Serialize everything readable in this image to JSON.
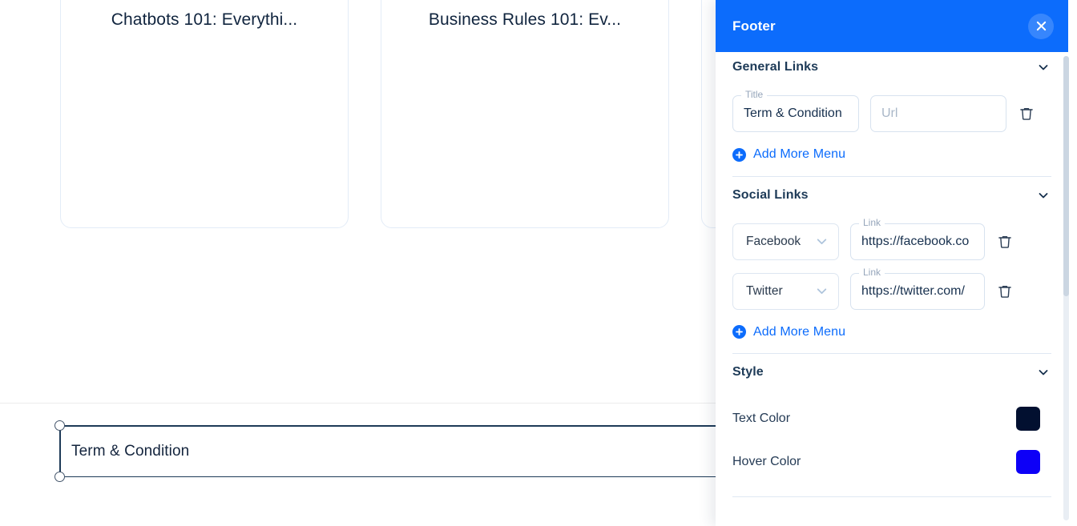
{
  "canvas": {
    "cards": [
      {
        "title": "Chatbots 101: Everythi..."
      },
      {
        "title": "Business Rules 101: Ev..."
      },
      {
        "title": ""
      }
    ],
    "selected_element": {
      "label": "Term & Condition"
    }
  },
  "panel": {
    "header": {
      "title": "Footer",
      "close_label": "×"
    },
    "sections": [
      {
        "id": "general-links",
        "title": "General Links",
        "rows": [
          {
            "title_legend": "Title",
            "title_value": "Term & Condition",
            "url_placeholder": "Url",
            "url_value": ""
          }
        ],
        "add_more_label": "Add More Menu"
      },
      {
        "id": "social-links",
        "title": "Social Links",
        "rows": [
          {
            "network": "Facebook",
            "link_legend": "Link",
            "link_value": "https://facebook.co"
          },
          {
            "network": "Twitter",
            "link_legend": "Link",
            "link_value": "https://twitter.com/"
          }
        ],
        "add_more_label": "Add More Menu"
      },
      {
        "id": "style",
        "title": "Style",
        "rows": [
          {
            "label": "Text Color",
            "color": "#021030"
          },
          {
            "label": "Hover Color",
            "color": "#0D00F7"
          }
        ]
      }
    ],
    "network_options": [
      "Facebook",
      "Twitter"
    ]
  },
  "colors": {
    "accent": "#0C6CFC",
    "text_dark": "#1D3A57",
    "border": "#D7E2EF"
  }
}
